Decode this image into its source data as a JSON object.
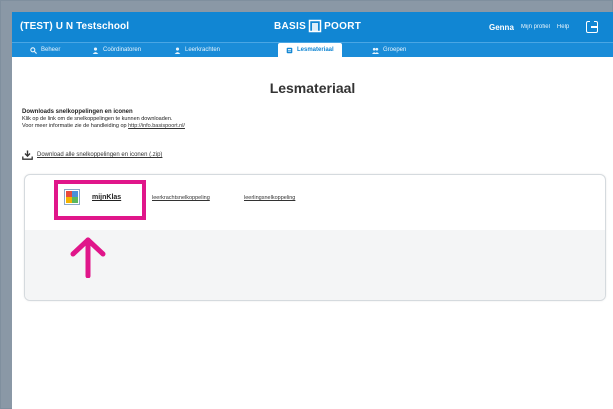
{
  "header": {
    "school_name": "(TEST) U N Testschool",
    "logo_left": "BASIS",
    "logo_right": "POORT",
    "user_name": "Genna",
    "profile_link": "Mijn profiel",
    "help_link": "Help"
  },
  "tabs": [
    {
      "label": "Beheer",
      "icon": "magnifier-icon"
    },
    {
      "label": "Coördinatoren",
      "icon": "person-icon"
    },
    {
      "label": "Leerkrachten",
      "icon": "person-icon"
    },
    {
      "label": "Lesmateriaal",
      "icon": "book-icon",
      "active": true
    },
    {
      "label": "Groepen",
      "icon": "group-icon"
    }
  ],
  "page": {
    "title": "Lesmateriaal",
    "section_heading": "Downloads snelkoppelingen en iconen",
    "line1": "Klik op de link om de snelkoppelingen te kunnen downloaden.",
    "line2_prefix": "Voor meer informatie zie de handleiding op ",
    "line2_link": "http://info.basispoort.nl/",
    "download_all": "Download alle snelkoppelingen en iconen (.zip)"
  },
  "material": {
    "app_name": "mijnKlas",
    "teacher_link": "leerkrachtsnelkoppeling",
    "student_link": "leerlingsnelkoppeling"
  },
  "colors": {
    "brand_blue": "#1186d3",
    "highlight_pink": "#e0168a"
  }
}
